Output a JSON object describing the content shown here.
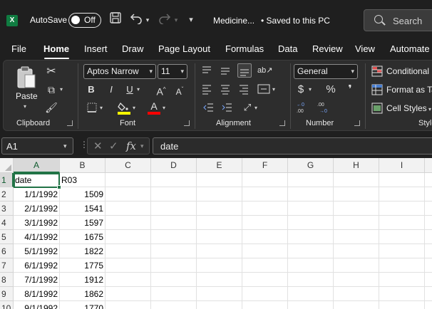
{
  "titlebar": {
    "app_icon": "X",
    "autosave_label": "AutoSave",
    "autosave_state": "Off",
    "file_name": "Medicine...",
    "save_status": "• Saved to this PC",
    "search_placeholder": "Search",
    "icons": [
      "excel-logo-icon",
      "save-icon",
      "undo-icon",
      "redo-icon",
      "customize-qat-icon",
      "search-icon"
    ]
  },
  "tabs": [
    {
      "label": "File"
    },
    {
      "label": "Home",
      "active": true
    },
    {
      "label": "Insert"
    },
    {
      "label": "Draw"
    },
    {
      "label": "Page Layout"
    },
    {
      "label": "Formulas"
    },
    {
      "label": "Data"
    },
    {
      "label": "Review"
    },
    {
      "label": "View"
    },
    {
      "label": "Automate"
    }
  ],
  "ribbon": {
    "clipboard": {
      "label": "Clipboard",
      "paste_label": "Paste"
    },
    "font": {
      "label": "Font",
      "font_name": "Aptos Narrow",
      "font_size": "11",
      "grow": "A",
      "shrink": "A",
      "bold": "B",
      "italic": "I",
      "underline": "U",
      "font_color_letter": "A",
      "highlight_color": "#ffff00",
      "font_color": "#ff0000"
    },
    "alignment": {
      "label": "Alignment"
    },
    "number": {
      "label": "Number",
      "format": "General",
      "currency": "$",
      "percent": "%",
      "comma": "❜",
      "inc_decimal": "←0\n.00",
      "dec_decimal": ".00\n→0"
    },
    "styles": {
      "label": "Styles",
      "conditional": "Conditional",
      "format_as_table": "Format as Ta",
      "cell_styles": "Cell Styles"
    }
  },
  "formula_bar": {
    "name_box": "A1",
    "cancel": "✕",
    "enter": "✓",
    "fx": "fx",
    "content": "date"
  },
  "sheet": {
    "columns": [
      "A",
      "B",
      "C",
      "D",
      "E",
      "F",
      "G",
      "H",
      "I"
    ],
    "selected_column": "A",
    "selected_row": "1",
    "rows": [
      {
        "num": "1",
        "a": "date",
        "b": "R03"
      },
      {
        "num": "2",
        "a": "1/1/1992",
        "b": "1509"
      },
      {
        "num": "3",
        "a": "2/1/1992",
        "b": "1541"
      },
      {
        "num": "4",
        "a": "3/1/1992",
        "b": "1597"
      },
      {
        "num": "5",
        "a": "4/1/1992",
        "b": "1675"
      },
      {
        "num": "6",
        "a": "5/1/1992",
        "b": "1822"
      },
      {
        "num": "7",
        "a": "6/1/1992",
        "b": "1775"
      },
      {
        "num": "8",
        "a": "7/1/1992",
        "b": "1912"
      },
      {
        "num": "9",
        "a": "8/1/1992",
        "b": "1862"
      },
      {
        "num": "10",
        "a": "9/1/1992",
        "b": "1770"
      }
    ]
  }
}
